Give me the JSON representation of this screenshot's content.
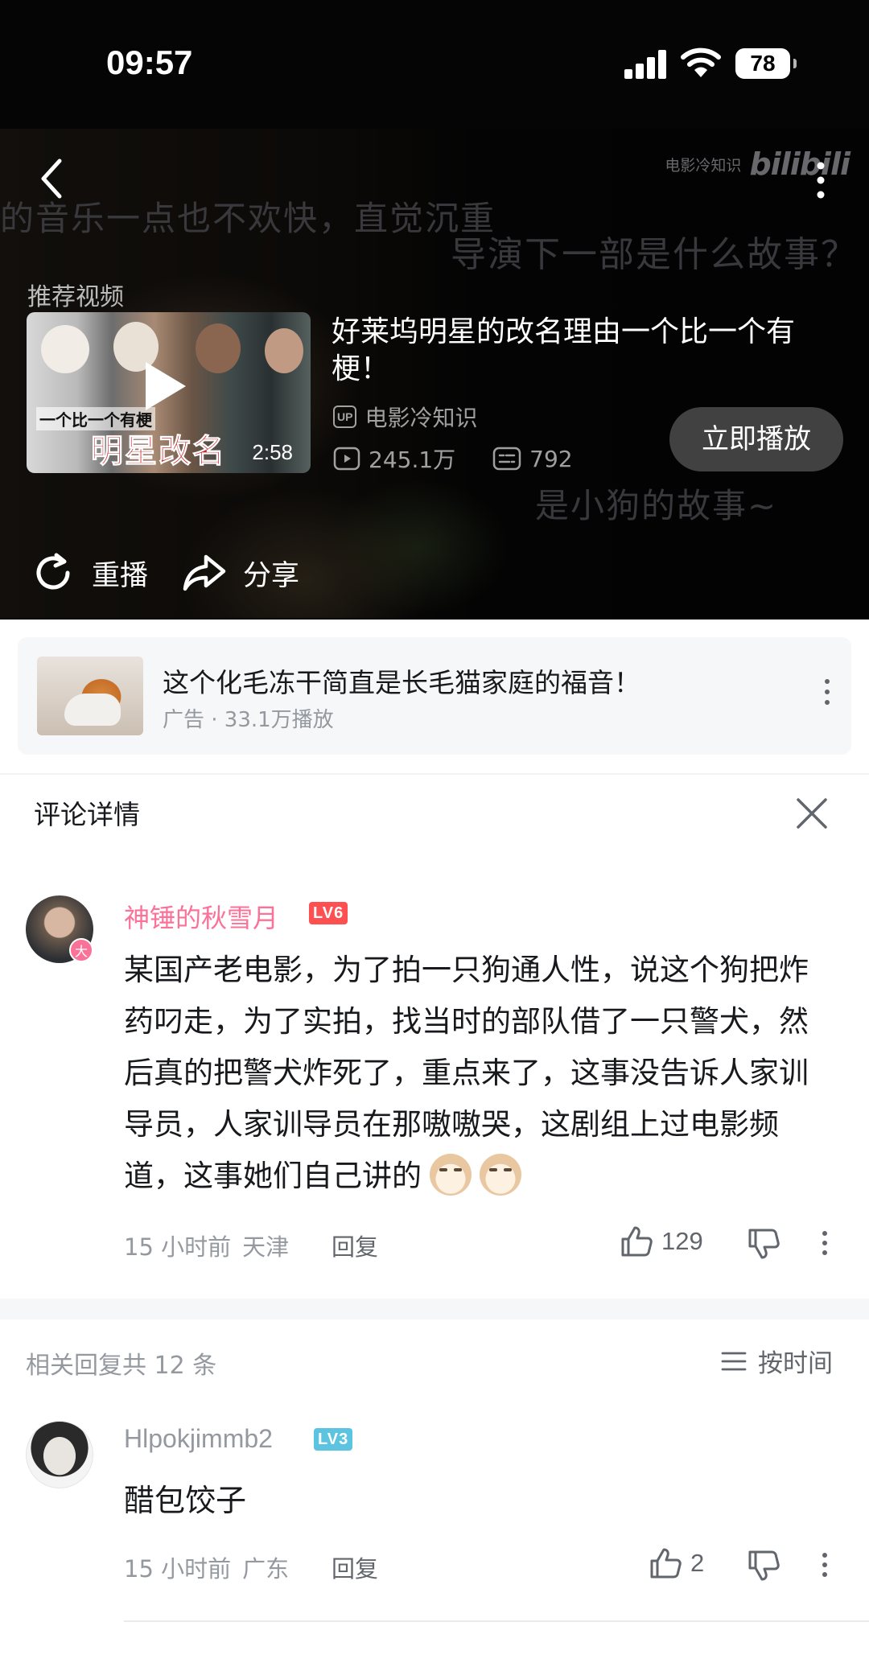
{
  "status_bar": {
    "time": "09:57",
    "battery": "78"
  },
  "player": {
    "danmaku": [
      "的音乐一点也不欢快，直觉沉重",
      "导演下一部是什么故事？",
      "是小狗的故事~"
    ],
    "watermark_text": "电影冷知识",
    "watermark_logo": "bilibili",
    "recommend_label": "推荐视频",
    "recommended_video": {
      "title": "好莱坞明星的改名理由一个比一个有梗！",
      "thumb_caption_small": "一个比一个有梗",
      "thumb_caption_big": "明星改名",
      "duration": "2:58",
      "up_badge": "UP",
      "uploader": "电影冷知识",
      "views": "245.1万",
      "danmaku_count": "792",
      "play_now_label": "立即播放"
    },
    "replay_label": "重播",
    "share_label": "分享"
  },
  "ad": {
    "title": "这个化毛冻干简直是长毛猫家庭的福音！",
    "subtitle": "广告 · 33.1万播放"
  },
  "comment_detail": {
    "header": "评论详情",
    "main_comment": {
      "avatar_badge": "大",
      "username": "神锤的秋雪月",
      "level": "LV6",
      "text": "某国产老电影，为了拍一只狗通人性，说这个狗把炸药叼走，为了实拍，找当时的部队借了一只警犬，然后真的把警犬炸死了，重点来了，这事没告诉人家训导员，人家训导员在那嗷嗷哭，这剧组上过电影频道，这事她们自己讲的",
      "time": "15 小时前",
      "location": "天津",
      "reply_label": "回复",
      "likes": "129"
    },
    "replies_count_text": "相关回复共 12 条",
    "sort_label": "按时间",
    "replies": [
      {
        "username": "Hlpokjimmb2",
        "level": "LV3",
        "text": "醋包饺子",
        "time": "15 小时前",
        "location": "广东",
        "reply_label": "回复",
        "likes": "2"
      }
    ]
  }
}
